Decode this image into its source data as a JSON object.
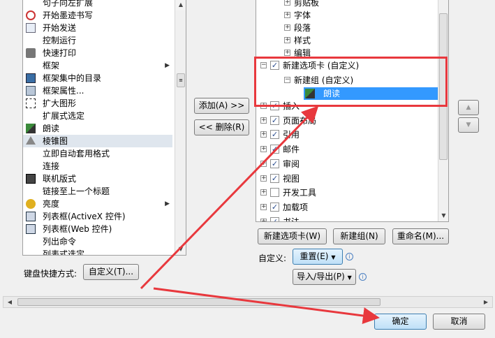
{
  "commands": [
    {
      "label": "句子向左扩展",
      "icon": "none",
      "submenu": false
    },
    {
      "label": "开始墨迹书写",
      "icon": "pen-icon",
      "submenu": false
    },
    {
      "label": "开始发送",
      "icon": "mail-icon",
      "submenu": false
    },
    {
      "label": "控制运行",
      "icon": "none",
      "submenu": false
    },
    {
      "label": "快速打印",
      "icon": "printer-icon",
      "submenu": false
    },
    {
      "label": "框架",
      "icon": "none",
      "submenu": true
    },
    {
      "label": "框架集中的目录",
      "icon": "frame-toc-icon",
      "submenu": false
    },
    {
      "label": "框架属性...",
      "icon": "frame-props-icon",
      "submenu": false
    },
    {
      "label": "扩大图形",
      "icon": "enlarge-icon",
      "submenu": false
    },
    {
      "label": "扩展式选定",
      "icon": "none",
      "submenu": false
    },
    {
      "label": "朗读",
      "icon": "speak-icon",
      "submenu": false
    },
    {
      "label": "棱锥图",
      "icon": "pyramid-icon",
      "submenu": false
    },
    {
      "label": "立即自动套用格式",
      "icon": "none",
      "submenu": false
    },
    {
      "label": "连接",
      "icon": "none",
      "submenu": false
    },
    {
      "label": "联机版式",
      "icon": "online-layout-icon",
      "submenu": false
    },
    {
      "label": "链接至上一个标题",
      "icon": "none",
      "submenu": false
    },
    {
      "label": "亮度",
      "icon": "brightness-icon",
      "submenu": true
    },
    {
      "label": "列表框(ActiveX 控件)",
      "icon": "listbox-icon",
      "submenu": false
    },
    {
      "label": "列表框(Web 控件)",
      "icon": "listbox-icon",
      "submenu": false
    },
    {
      "label": "列出命令",
      "icon": "none",
      "submenu": false
    },
    {
      "label": "列表式选定",
      "icon": "none",
      "submenu": false
    }
  ],
  "buttons": {
    "add": "添加(A) >>",
    "remove": "<< 删除(R)",
    "new_tab": "新建选项卡(W)",
    "new_group": "新建组(N)",
    "rename": "重命名(M)...",
    "reset": "重置(E)",
    "import_export": "导入/导出(P)",
    "customize": "自定义(T)...",
    "ok": "确定",
    "cancel": "取消"
  },
  "keyboard_label": "键盘快捷方式:",
  "customize_label": "自定义:",
  "tree": {
    "top_items": [
      "剪贴板",
      "字体",
      "段落",
      "样式",
      "编辑"
    ],
    "new_tab": "新建选项卡 (自定义)",
    "new_group": "新建组 (自定义)",
    "new_item": "朗读",
    "tabs": [
      {
        "label": "插入",
        "checked": true
      },
      {
        "label": "页面布局",
        "checked": true
      },
      {
        "label": "引用",
        "checked": true
      },
      {
        "label": "邮件",
        "checked": true
      },
      {
        "label": "审阅",
        "checked": true
      },
      {
        "label": "视图",
        "checked": true
      },
      {
        "label": "开发工具",
        "checked": false
      },
      {
        "label": "加载项",
        "checked": true
      },
      {
        "label": "书法",
        "checked": true
      }
    ]
  },
  "colors": {
    "highlight_red": "#e8383d",
    "selection_blue": "#3399ff"
  }
}
